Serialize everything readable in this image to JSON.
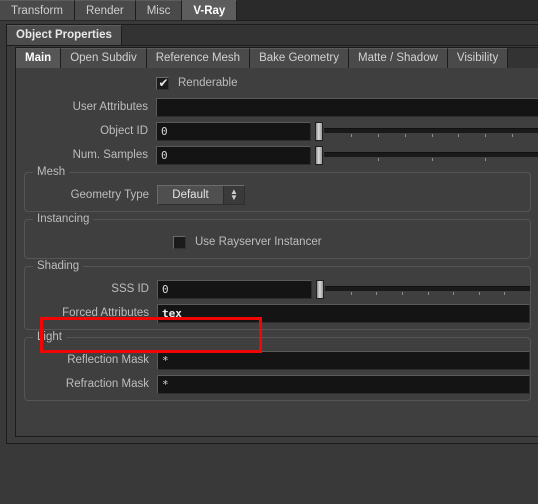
{
  "outer_tabs": [
    {
      "label": "Transform",
      "active": false
    },
    {
      "label": "Render",
      "active": false
    },
    {
      "label": "Misc",
      "active": false
    },
    {
      "label": "V-Ray",
      "active": true
    }
  ],
  "panel": {
    "tab_label": "Object Properties"
  },
  "inner_tabs": [
    {
      "label": "Main",
      "active": true
    },
    {
      "label": "Open Subdiv",
      "active": false
    },
    {
      "label": "Reference Mesh",
      "active": false
    },
    {
      "label": "Bake Geometry",
      "active": false
    },
    {
      "label": "Matte / Shadow",
      "active": false
    },
    {
      "label": "Visibility",
      "active": false
    }
  ],
  "main": {
    "renderable": {
      "label": "Renderable",
      "checked": true,
      "icon": "checkmark-icon"
    },
    "user_attributes": {
      "label": "User Attributes",
      "value": "",
      "placeholder": ""
    },
    "object_id": {
      "label": "Object ID",
      "value": "0",
      "slider_ticks": 7
    },
    "num_samples": {
      "label": "Num. Samples",
      "value": "0",
      "slider_ticks": 3
    }
  },
  "mesh": {
    "title": "Mesh",
    "geometry_type": {
      "label": "Geometry Type",
      "value": "Default",
      "spinner_icon": "updown-arrows-icon"
    }
  },
  "instancing": {
    "title": "Instancing",
    "use_rayserver_instancer": {
      "label": "Use Rayserver Instancer",
      "checked": false
    }
  },
  "shading": {
    "title": "Shading",
    "sss_id": {
      "label": "SSS ID",
      "value": "0",
      "slider_ticks": 7
    },
    "forced_attributes": {
      "label": "Forced Attributes",
      "value": "tex",
      "highlighted": true
    }
  },
  "light": {
    "title": "Light",
    "reflection_mask": {
      "label": "Reflection Mask",
      "value": "*"
    },
    "refraction_mask": {
      "label": "Refraction Mask",
      "value": "*"
    }
  },
  "annotation": {
    "highlight_color": "#f20505",
    "target": "forced-attributes-row"
  },
  "colors": {
    "window_bg": "#393939",
    "panel_bg": "#3f3f3f",
    "field_bg": "#141414",
    "tab_active": "#5d5d5d",
    "text": "#c8c8c8",
    "highlight": "#f20505"
  }
}
